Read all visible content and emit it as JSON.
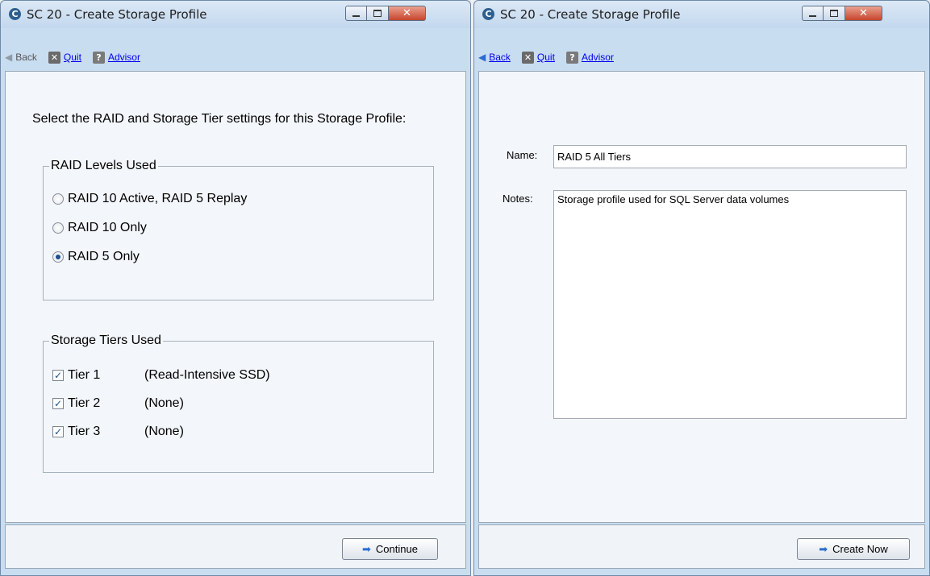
{
  "left_window": {
    "title": "SC 20 - Create Storage Profile",
    "app_icon": "C",
    "toolbar": {
      "back_label": "Back",
      "quit_label": "Quit",
      "advisor_label": "Advisor"
    },
    "instruction": "Select the RAID and Storage Tier settings for this Storage Profile:",
    "raid_group": {
      "legend": "RAID Levels Used",
      "options": [
        {
          "label": "RAID 10 Active, RAID 5 Replay",
          "checked": false
        },
        {
          "label": "RAID 10 Only",
          "checked": false
        },
        {
          "label": "RAID 5 Only",
          "checked": true
        }
      ]
    },
    "tier_group": {
      "legend": "Storage Tiers Used",
      "tiers": [
        {
          "name": "Tier 1",
          "desc": "(Read-Intensive SSD)",
          "checked": true
        },
        {
          "name": "Tier 2",
          "desc": "(None)",
          "checked": true
        },
        {
          "name": "Tier 3",
          "desc": "(None)",
          "checked": true
        }
      ]
    },
    "continue_label": "Continue"
  },
  "right_window": {
    "title": "SC 20 - Create Storage Profile",
    "app_icon": "C",
    "toolbar": {
      "back_label": "Back",
      "quit_label": "Quit",
      "advisor_label": "Advisor"
    },
    "name_label": "Name:",
    "name_value": "RAID 5 All Tiers",
    "notes_label": "Notes:",
    "notes_value": "Storage profile used for SQL Server data volumes",
    "create_label": "Create Now"
  },
  "icons": [
    "app-icon",
    "minimize-icon",
    "maximize-icon",
    "close-icon",
    "back-arrow-icon",
    "quit-icon",
    "advisor-icon",
    "continue-arrow-icon"
  ]
}
